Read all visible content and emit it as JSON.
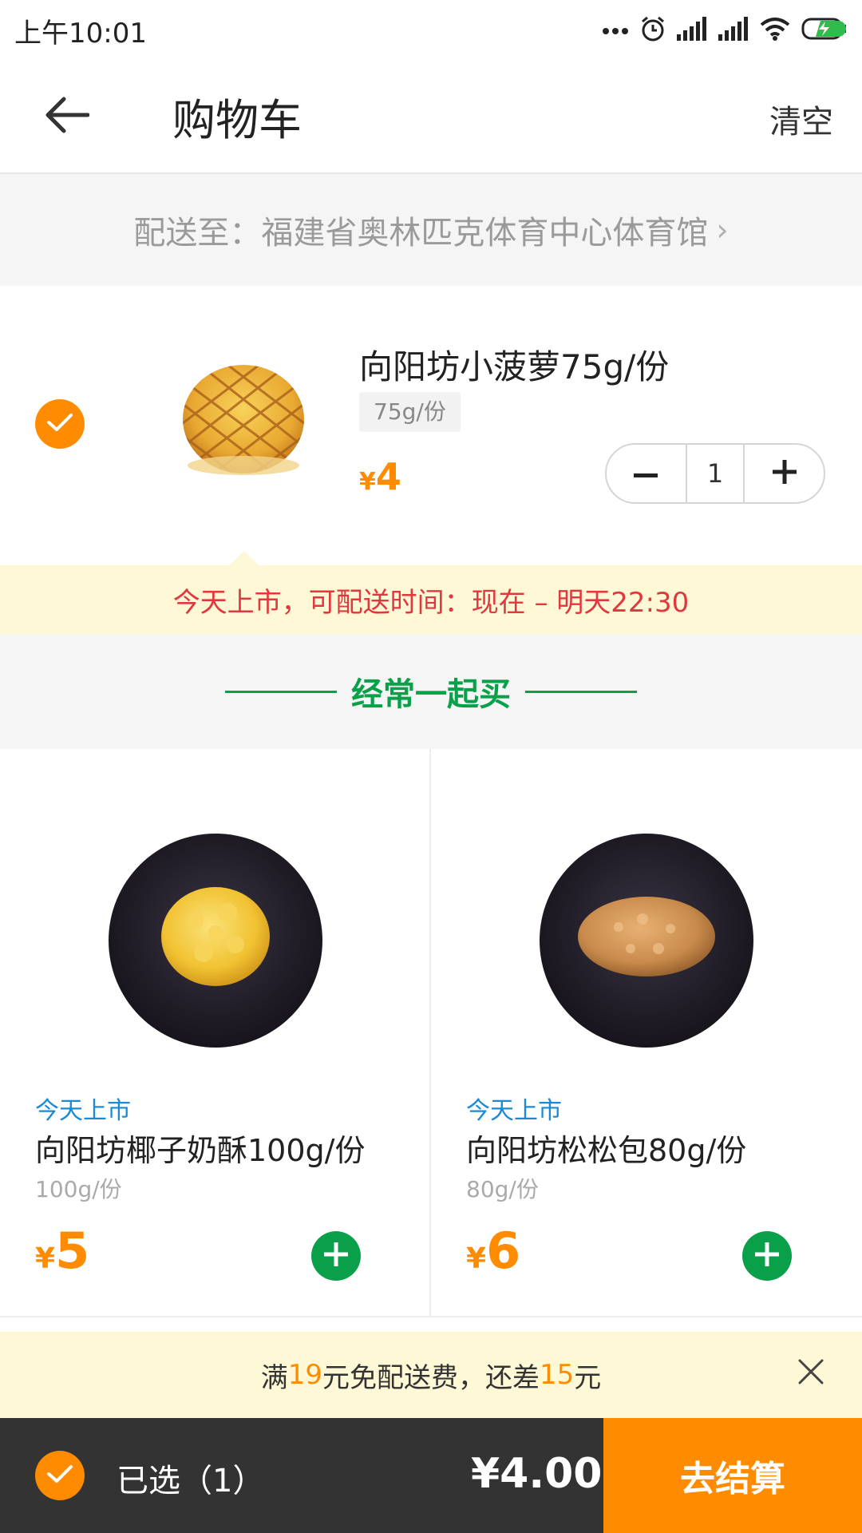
{
  "status_bar": {
    "time": "上午10:01",
    "icons": [
      "more-dots-icon",
      "alarm-icon",
      "signal-icon",
      "signal-icon",
      "wifi-icon",
      "battery-charging-icon"
    ]
  },
  "header": {
    "title": "购物车",
    "clear_label": "清空"
  },
  "address": {
    "text": "配送至：福建省奥林匹克体育中心体育馆",
    "chevron": "›"
  },
  "cart_item": {
    "selected": true,
    "name": "向阳坊小菠萝75g/份",
    "spec": "75g/份",
    "currency": "¥",
    "price": "4",
    "quantity": "1",
    "minus_label": "−",
    "plus_label": "+"
  },
  "delivery_notice": "今天上市，可配送时间：现在 – 明天22:30",
  "section": {
    "title": "经常一起买"
  },
  "products": [
    {
      "tag": "今天上市",
      "name": "向阳坊椰子奶酥100g/份",
      "spec": "100g/份",
      "currency": "¥",
      "price": "5"
    },
    {
      "tag": "今天上市",
      "name": "向阳坊松松包80g/份",
      "spec": "80g/份",
      "currency": "¥",
      "price": "6"
    }
  ],
  "shipping": {
    "prefix": "满",
    "threshold": "19",
    "middle": "元免配送费，还差",
    "remaining": "15",
    "suffix": "元"
  },
  "bottom_bar": {
    "selected_label": "已选（1）",
    "total": "¥4.00",
    "checkout_label": "去结算"
  },
  "colors": {
    "accent": "#ff8c00",
    "green": "#0aa04a",
    "notice_red": "#e0383e",
    "tag_blue": "#1a8ad4",
    "notice_bg": "#fff8d6",
    "bottom_bar_bg": "#333333"
  }
}
